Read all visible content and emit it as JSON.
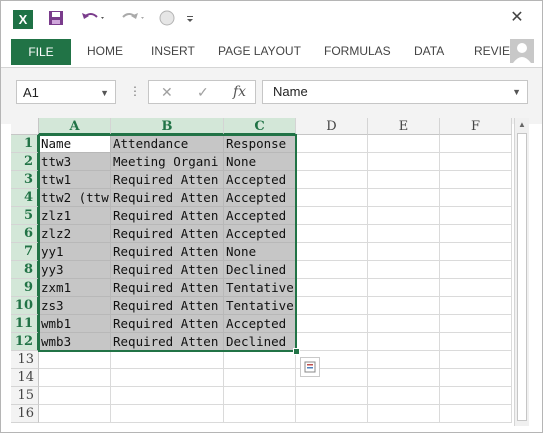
{
  "title_bar": {
    "app_icon_letter": "X",
    "close_glyph": "✕"
  },
  "ribbon": {
    "tabs": [
      "FILE",
      "HOME",
      "INSERT",
      "PAGE LAYOUT",
      "FORMULAS",
      "DATA",
      "REVIEW"
    ]
  },
  "formula_bar": {
    "name_box": "A1",
    "formula": "Name",
    "cancel_glyph": "✕",
    "enter_glyph": "✓",
    "fx_glyph": "fx"
  },
  "sheet": {
    "columns": [
      "A",
      "B",
      "C",
      "D",
      "E",
      "F"
    ],
    "selected_columns": [
      "A",
      "B",
      "C"
    ],
    "rows": [
      "1",
      "2",
      "3",
      "4",
      "5",
      "6",
      "7",
      "8",
      "9",
      "10",
      "11",
      "12",
      "13",
      "14",
      "15",
      "16"
    ],
    "selected_rows_count": 12,
    "data": [
      [
        "Name",
        "Attendance",
        "Response"
      ],
      [
        "ttw3",
        "Meeting Organi",
        "None"
      ],
      [
        "ttw1",
        "Required Atten",
        "Accepted"
      ],
      [
        "ttw2 (ttw",
        "Required Atten",
        "Accepted"
      ],
      [
        "zlz1",
        "Required Atten",
        "Accepted"
      ],
      [
        "zlz2",
        "Required Atten",
        "Accepted"
      ],
      [
        "yy1",
        "Required Atten",
        "None"
      ],
      [
        "yy3",
        "Required Atten",
        "Declined"
      ],
      [
        "zxm1",
        "Required Atten",
        "Tentative"
      ],
      [
        "zs3",
        "Required Atten",
        "Tentative"
      ],
      [
        "wmb1",
        "Required Atten",
        "Accepted"
      ],
      [
        "wmb3",
        "Required Atten",
        "Declined"
      ]
    ]
  },
  "colors": {
    "excel_green": "#217346",
    "selection_fill": "#c6c6c6",
    "header_highlight": "#d3e7d8"
  },
  "icons": [
    "excel-logo-icon",
    "save-icon",
    "undo-icon",
    "redo-icon",
    "touch-mode-icon",
    "customize-qat-icon",
    "close-icon",
    "account-icon",
    "quick-analysis-icon"
  ]
}
